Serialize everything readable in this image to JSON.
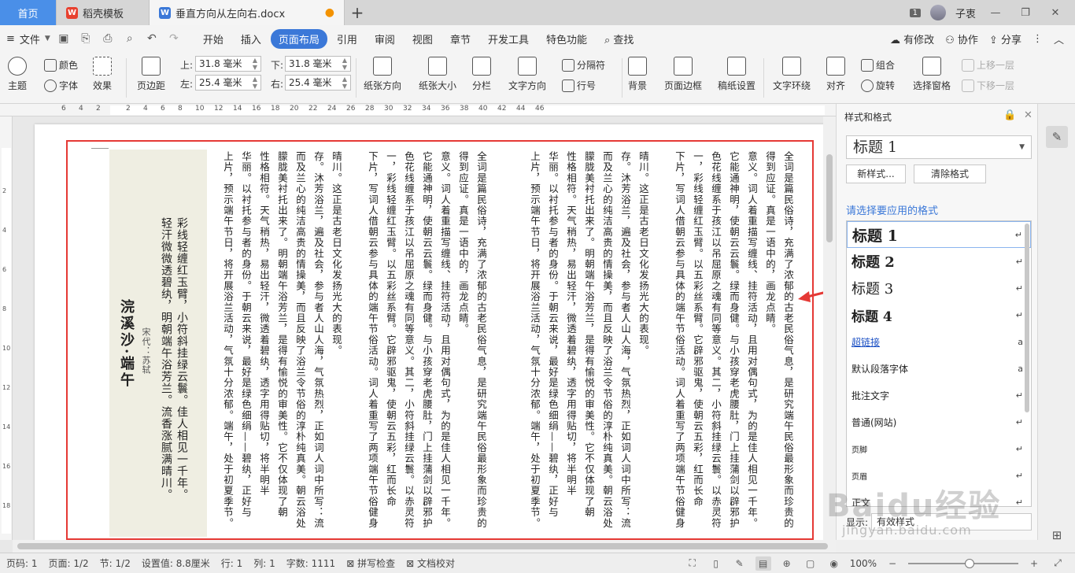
{
  "titlebar": {
    "tabs": [
      {
        "label": "首页"
      },
      {
        "label": "稻壳模板"
      },
      {
        "label": "垂直方向从左向右.docx"
      }
    ],
    "new_tab": "+",
    "badge": "1",
    "user": "子衷"
  },
  "menubar": {
    "file": "文件",
    "tabs": [
      "开始",
      "插入",
      "页面布局",
      "引用",
      "审阅",
      "视图",
      "章节",
      "开发工具",
      "特色功能"
    ],
    "active_tab": "页面布局",
    "search": "查找",
    "right": [
      "有修改",
      "协作",
      "分享"
    ]
  },
  "ribbon": {
    "theme": "主题",
    "color": "颜色",
    "font": "字体",
    "effect": "效果",
    "margin": "页边距",
    "top_label": "上:",
    "top_value": "31.8 毫米",
    "bottom_label": "下:",
    "bottom_value": "31.8 毫米",
    "left_label": "左:",
    "left_value": "25.4 毫米",
    "right_label": "右:",
    "right_value": "25.4 毫米",
    "orientation": "纸张方向",
    "size": "纸张大小",
    "columns": "分栏",
    "text_direction": "文字方向",
    "separator": "分隔符",
    "line_number": "行号",
    "background": "背景",
    "page_border": "页面边框",
    "manuscript": "稿纸设置",
    "text_wrap": "文字环绕",
    "align": "对齐",
    "group": "组合",
    "rotate": "旋转",
    "select_pane": "选择窗格",
    "bring_forward": "上移一层",
    "send_backward": "下移一层"
  },
  "ruler": {
    "h_numbers": [
      "6",
      "4",
      "2",
      "2",
      "4",
      "6",
      "8",
      "10",
      "12",
      "14",
      "16",
      "18",
      "20",
      "22",
      "24",
      "26",
      "28",
      "30",
      "32",
      "34",
      "36",
      "38",
      "40",
      "42",
      "44",
      "46"
    ],
    "v_numbers": [
      "2",
      "4",
      "6",
      "8",
      "10",
      "12",
      "14",
      "16",
      "18"
    ]
  },
  "document": {
    "poem_title": "浣溪沙·端午",
    "poem_author": "宋代：苏轼",
    "poem_lines": [
      "轻汗微微透碧纨，明朝端午浴芳兰。流香涨腻满晴川。",
      "彩线轻缠红玉臂，小符斜挂绿云鬟。佳人相见一千年。"
    ],
    "columns": [
      "全词是篇民俗诗，充满了浓郁的古老民俗气息，是研究端午民俗最形象而珍贵的",
      "得到应证。真是一语中的，画龙点睛。",
      "意义。词人着重描写缠线、挂符活动，且用对偶句式，为的是佳人相见一千年。",
      "它能通神明，使朝云云鬟。绿而身健。与小孩穿老虎腰肚，门上挂蒲剑以辟邪护",
      "色花线缠系于孩江以吊屈原之魂有同等意义。其二，小符斜挂绿云鬟。以赤灵符",
      "一，彩线轻缠红玉臂。以五彩丝系臂。它辟邪驱鬼，使朝云五彩，红而长命",
      "下片，写词人借朝云参与具体的端午节俗活动。词人着重写了两项端午节俗健身",
      "晴川。这正是古老日文化发扬光大的表现。",
      "存。沐芳浴兰，遍及社会，参与者人山人海，气氛热烈，正如词人词中所写：流",
      "而及兰心的纯洁高贵的情操美，而且反映了浴兰令节俗的淳朴纯真美。朝云浴处",
      "朦胧美衬托出来了。明朝端午浴芳兰，是得有愉悦的审美性。它不仅体现了朝",
      "性格相符。天气稍热，易出轻汗，微透着碧纨，透字用得贴切，将半明半",
      "华丽。以衬托参与者的身份。于朝云来说，最好是绿色细绢——碧纨，正好与",
      "上片，预示端午节日，将开展浴兰活动，气氛十分浓郁。端午，处于初夏季节。"
    ]
  },
  "panel": {
    "title": "样式和格式",
    "current_style": "标题 1",
    "new_style": "新样式...",
    "clear_format": "清除格式",
    "choose_label": "请选择要应用的格式",
    "styles": [
      {
        "name": "标题 1",
        "mark": "↵"
      },
      {
        "name": "标题 2",
        "mark": "↵"
      },
      {
        "name": "标题 3",
        "mark": "↵"
      },
      {
        "name": "标题 4",
        "mark": "↵"
      },
      {
        "name": "超链接",
        "mark": "a"
      },
      {
        "name": "默认段落字体",
        "mark": "a"
      },
      {
        "name": "批注文字",
        "mark": "↵"
      },
      {
        "name": "普通(网站)",
        "mark": "↵"
      },
      {
        "name": "页脚",
        "mark": "↵"
      },
      {
        "name": "页眉",
        "mark": "↵"
      },
      {
        "name": "正文",
        "mark": "↵"
      }
    ],
    "display_label": "显示:",
    "display_value": "有效样式"
  },
  "statusbar": {
    "page_no": "页码: 1",
    "pages": "页面: 1/2",
    "section": "节: 1/2",
    "setting": "设置值: 8.8厘米",
    "row": "行: 1",
    "col": "列: 1",
    "words": "字数: 1111",
    "spell": "拼写检查",
    "proof": "文档校对",
    "zoom": "100%"
  },
  "watermark": {
    "brand": "Baidu经验",
    "url": "jingyan.baidu.com"
  },
  "colors": {
    "accent": "#3b78d8",
    "annotation": "#e53935",
    "poem_bg": "#efeee2"
  }
}
